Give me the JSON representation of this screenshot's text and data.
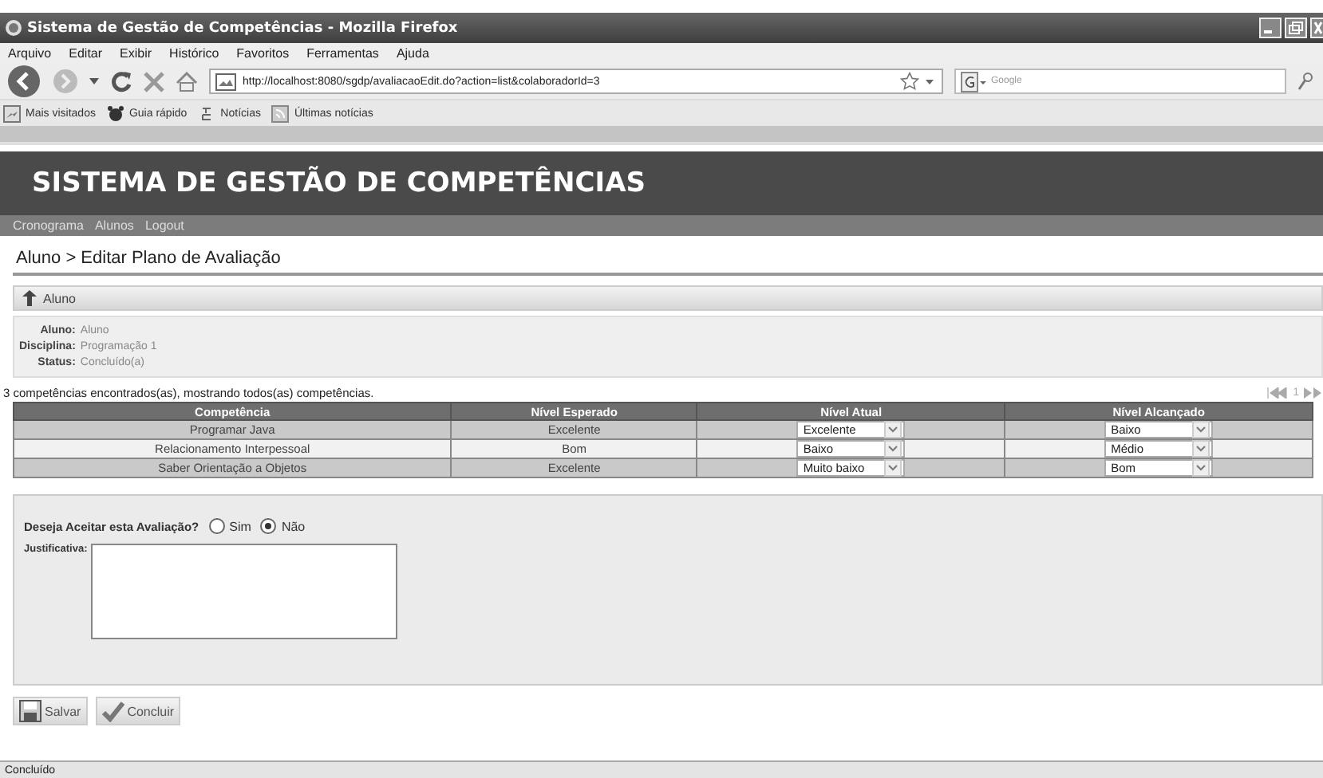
{
  "window": {
    "title": "Sistema de Gestão de Competências - Mozilla Firefox"
  },
  "menu": [
    "Arquivo",
    "Editar",
    "Exibir",
    "Histórico",
    "Favoritos",
    "Ferramentas",
    "Ajuda"
  ],
  "address": {
    "value": "http://localhost:8080/sgdp/avaliacaoEdit.do?action=list&colaboradorId=3"
  },
  "search": {
    "placeholder": "Google"
  },
  "bookmarks": [
    {
      "label": "Mais visitados",
      "kind": "page"
    },
    {
      "label": "Guia rápido",
      "kind": "paw"
    },
    {
      "label": "Notícias",
      "kind": "news"
    },
    {
      "label": "Últimas notícias",
      "kind": "feed"
    }
  ],
  "header": {
    "title": "SISTEMA DE GESTÃO DE COMPETÊNCIAS",
    "nav": [
      "Cronograma",
      "Alunos",
      "Logout"
    ]
  },
  "breadcrumb": "Aluno > Editar Plano de Avaliação",
  "back_link": "Aluno",
  "info": [
    {
      "label": "Aluno:",
      "value": "Aluno"
    },
    {
      "label": "Disciplina:",
      "value": "Programação 1"
    },
    {
      "label": "Status:",
      "value": "Concluído(a)"
    }
  ],
  "table": {
    "summary": "3 competências encontrados(as), mostrando todos(as) competências.",
    "pager": {
      "page": "1"
    },
    "columns": [
      "Competência",
      "Nível Esperado",
      "Nível Atual",
      "Nível Alcançado"
    ],
    "rows": [
      {
        "competencia": "Programar Java",
        "esperado": "Excelente",
        "atual": "Excelente",
        "alcancado": "Baixo"
      },
      {
        "competencia": "Relacionamento Interpessoal",
        "esperado": "Bom",
        "atual": "Baixo",
        "alcancado": "Médio"
      },
      {
        "competencia": "Saber Orientação a Objetos",
        "esperado": "Excelente",
        "atual": "Muito baixo",
        "alcancado": "Bom"
      }
    ]
  },
  "form": {
    "question": "Deseja Aceitar esta Avaliação?",
    "options": [
      {
        "label": "Sim",
        "selected": false
      },
      {
        "label": "Não",
        "selected": true
      }
    ],
    "justification_label": "Justificativa:"
  },
  "buttons": [
    {
      "label": "Salvar",
      "kind": "save"
    },
    {
      "label": "Concluir",
      "kind": "check"
    }
  ],
  "status_bar": "Concluído"
}
